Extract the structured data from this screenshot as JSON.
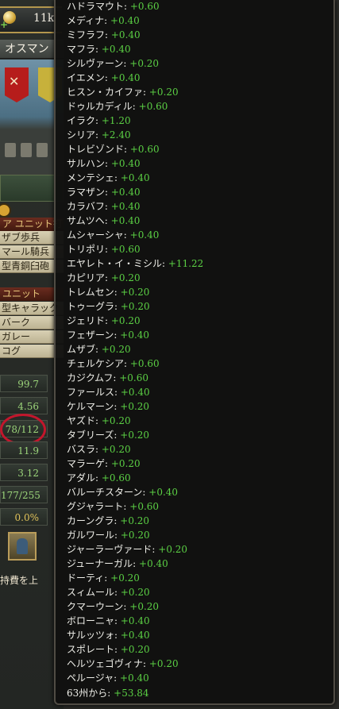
{
  "left_panel": {
    "treasury": "11k",
    "country_name": "オスマン",
    "unit_header": "ア ユニット打",
    "units": [
      "ザブ歩兵",
      "マール騎兵",
      "型青銅臼砲"
    ],
    "section_header": "ユニット",
    "ships": [
      "型キャラック",
      "バーク",
      "ガレー",
      "コグ"
    ],
    "stats": [
      "99.7",
      "4.56",
      "78/112",
      "11.9",
      "3.12",
      "177/255",
      "0.0%"
    ],
    "bottom_text": "持費を上"
  },
  "tooltip": {
    "entries": [
      {
        "name": "ハドラマウト:",
        "value": "+0.60"
      },
      {
        "name": "メディナ:",
        "value": "+0.40"
      },
      {
        "name": "ミフラフ:",
        "value": "+0.40"
      },
      {
        "name": "マフラ:",
        "value": "+0.40"
      },
      {
        "name": "シルヴァーン:",
        "value": "+0.20"
      },
      {
        "name": "イエメン:",
        "value": "+0.40"
      },
      {
        "name": "ヒスン・カイファ:",
        "value": "+0.20"
      },
      {
        "name": "ドゥルカディル:",
        "value": "+0.60"
      },
      {
        "name": "イラク:",
        "value": "+1.20"
      },
      {
        "name": "シリア:",
        "value": "+2.40"
      },
      {
        "name": "トレビゾンド:",
        "value": "+0.60"
      },
      {
        "name": "サルハン:",
        "value": "+0.40"
      },
      {
        "name": "メンテシェ:",
        "value": "+0.40"
      },
      {
        "name": "ラマザン:",
        "value": "+0.40"
      },
      {
        "name": "カラバフ:",
        "value": "+0.40"
      },
      {
        "name": "サムツヘ:",
        "value": "+0.40"
      },
      {
        "name": "ムシャーシャ:",
        "value": "+0.40"
      },
      {
        "name": "トリポリ:",
        "value": "+0.60"
      },
      {
        "name": "エヤレト・イ・ミシル:",
        "value": "+11.22"
      },
      {
        "name": "カピリア:",
        "value": "+0.20"
      },
      {
        "name": "トレムセン:",
        "value": "+0.20"
      },
      {
        "name": "トゥーグラ:",
        "value": "+0.20"
      },
      {
        "name": "ジェリド:",
        "value": "+0.20"
      },
      {
        "name": "フェザーン:",
        "value": "+0.40"
      },
      {
        "name": "ムザブ:",
        "value": "+0.20"
      },
      {
        "name": "チェルケシア:",
        "value": "+0.60"
      },
      {
        "name": "カジクムフ:",
        "value": "+0.60"
      },
      {
        "name": "ファールス:",
        "value": "+0.40"
      },
      {
        "name": "ケルマーン:",
        "value": "+0.20"
      },
      {
        "name": "ヤズド:",
        "value": "+0.20"
      },
      {
        "name": "タブリーズ:",
        "value": "+0.20"
      },
      {
        "name": "バスラ:",
        "value": "+0.20"
      },
      {
        "name": "マラーゲ:",
        "value": "+0.20"
      },
      {
        "name": "アダル:",
        "value": "+0.60"
      },
      {
        "name": "バルーチスターン:",
        "value": "+0.40"
      },
      {
        "name": "グジャラート:",
        "value": "+0.60"
      },
      {
        "name": "カーングラ:",
        "value": "+0.20"
      },
      {
        "name": "ガルワール:",
        "value": "+0.20"
      },
      {
        "name": "ジャーラーヴァード:",
        "value": "+0.20"
      },
      {
        "name": "ジューナーガル:",
        "value": "+0.40"
      },
      {
        "name": "ドーティ:",
        "value": "+0.20"
      },
      {
        "name": "スィムール:",
        "value": "+0.20"
      },
      {
        "name": "クマーウーン:",
        "value": "+0.20"
      },
      {
        "name": "ボローニャ:",
        "value": "+0.40"
      },
      {
        "name": "サルッツォ:",
        "value": "+0.40"
      },
      {
        "name": "スポレート:",
        "value": "+0.20"
      },
      {
        "name": "ヘルツェゴヴィナ:",
        "value": "+0.20"
      },
      {
        "name": "ペルージャ:",
        "value": "+0.40"
      }
    ],
    "total_label": "63州から:",
    "total_value": "+53.84"
  },
  "colors": {
    "positive": "#5bd044",
    "accent_red": "#c3162c",
    "gold": "#b3964d"
  }
}
